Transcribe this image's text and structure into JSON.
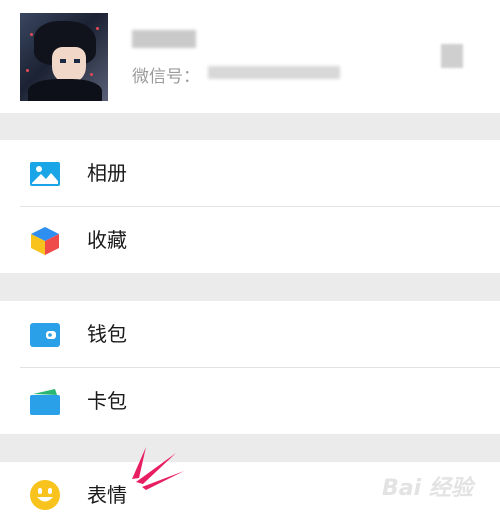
{
  "profile": {
    "nickname": "",
    "wechat_id_label": "微信号：",
    "wechat_id_value": ""
  },
  "menu": {
    "group1": [
      {
        "label": "相册",
        "icon": "album-icon"
      },
      {
        "label": "收藏",
        "icon": "favorites-cube-icon"
      }
    ],
    "group2": [
      {
        "label": "钱包",
        "icon": "wallet-icon"
      },
      {
        "label": "卡包",
        "icon": "card-package-icon"
      }
    ],
    "group3": [
      {
        "label": "表情",
        "icon": "emoji-smile-icon"
      }
    ]
  },
  "watermark": "Bai 经验",
  "colors": {
    "background": "#ebebeb",
    "album_blue": "#1aa6e6",
    "wallet_blue": "#2aa0e8",
    "emoji_yellow": "#f7c31c",
    "annotation_pink": "#e81e63"
  }
}
